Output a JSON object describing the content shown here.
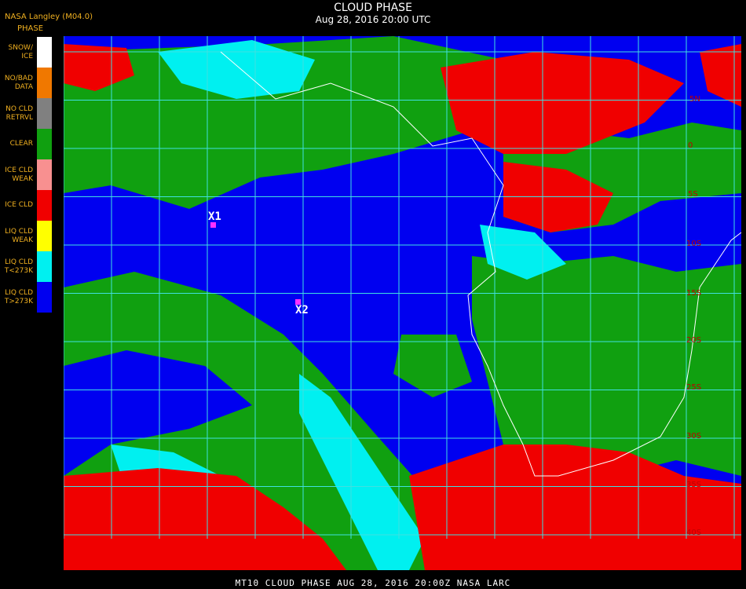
{
  "header": {
    "credit": "NASA Langley (M04.0)",
    "phase_title": "PHASE",
    "title": "CLOUD PHASE",
    "subtitle": "Aug 28, 2016 20:00 UTC"
  },
  "legend": [
    {
      "label": "SNOW/\nICE",
      "color": "#ffffff"
    },
    {
      "label": "NO/BAD\nDATA",
      "color": "#f07800"
    },
    {
      "label": "NO CLD\nRETRVL",
      "color": "#808080"
    },
    {
      "label": "CLEAR",
      "color": "#10a010"
    },
    {
      "label": "ICE CLD\nWEAK",
      "color": "#f89090"
    },
    {
      "label": "ICE CLD",
      "color": "#f00000"
    },
    {
      "label": "LIQ CLD\nWEAK",
      "color": "#ffff00"
    },
    {
      "label": "LIQ CLD\nT<273K",
      "color": "#00f0f0"
    },
    {
      "label": "LIQ CLD\nT>273K",
      "color": "#0000f0"
    }
  ],
  "markers": [
    {
      "label": "X1"
    },
    {
      "label": "X2"
    }
  ],
  "lat_labels": [
    "5N",
    "0",
    "5S",
    "10S",
    "15S",
    "20S",
    "25S",
    "30S",
    "35S",
    "40S"
  ],
  "footer": "MT10  CLOUD PHASE   AUG 28, 2016 20:00Z   NASA LARC",
  "colors": {
    "grid": "#40e0e0",
    "coast": "#ffffff",
    "marker": "#ff30ff"
  }
}
